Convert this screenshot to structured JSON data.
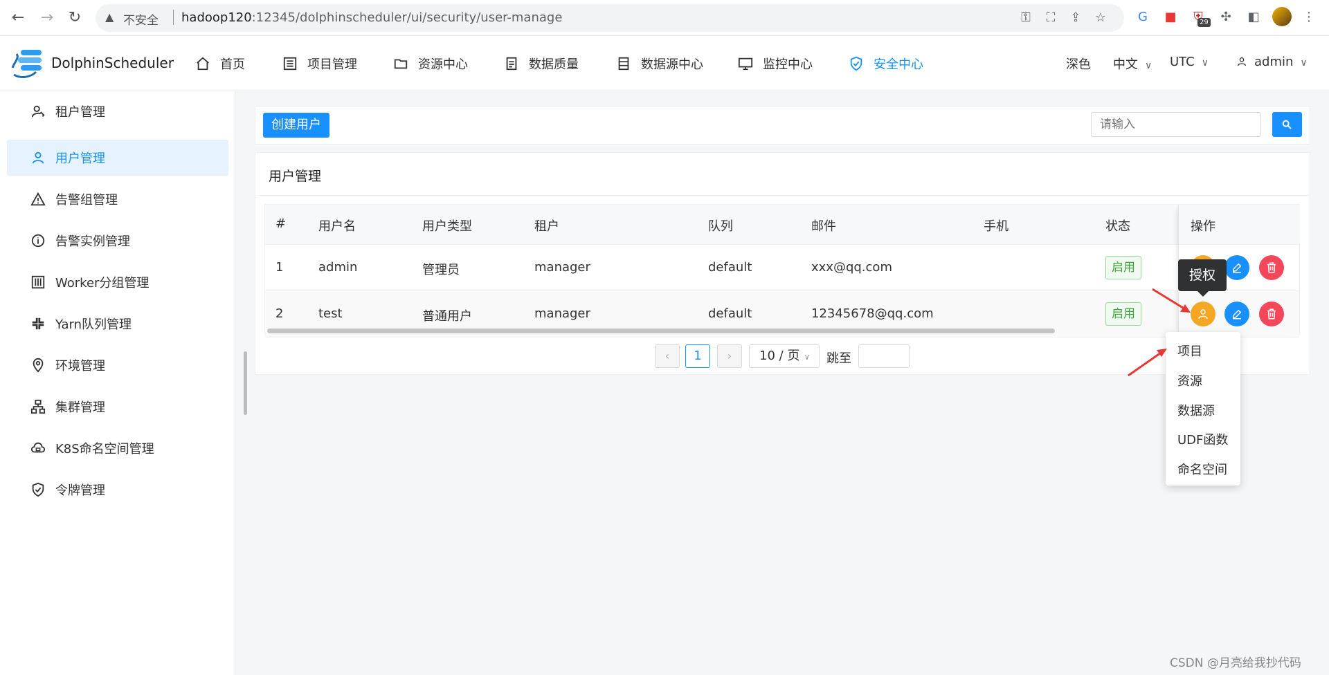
{
  "browser": {
    "insecure_label": "不安全",
    "url_host": "hadoop120",
    "url_path": ":12345/dolphinscheduler/ui/security/user-manage",
    "ext_badge": "29"
  },
  "header": {
    "brand": "DolphinScheduler",
    "nav": [
      {
        "label": "首页",
        "icon": "home-icon"
      },
      {
        "label": "项目管理",
        "icon": "project-list-icon"
      },
      {
        "label": "资源中心",
        "icon": "folder-icon"
      },
      {
        "label": "数据质量",
        "icon": "document-icon"
      },
      {
        "label": "数据源中心",
        "icon": "database-icon"
      },
      {
        "label": "监控中心",
        "icon": "monitor-icon"
      },
      {
        "label": "安全中心",
        "icon": "shield-check-icon",
        "active": true
      }
    ],
    "theme_label": "深色",
    "language": "中文",
    "timezone": "UTC",
    "user": "admin"
  },
  "sidebar": {
    "items": [
      {
        "label": "租户管理",
        "icon": "tenant-icon"
      },
      {
        "label": "用户管理",
        "icon": "user-icon",
        "active": true
      },
      {
        "label": "告警组管理",
        "icon": "warning-icon"
      },
      {
        "label": "告警实例管理",
        "icon": "info-icon"
      },
      {
        "label": "Worker分组管理",
        "icon": "worker-group-icon"
      },
      {
        "label": "Yarn队列管理",
        "icon": "yarn-queue-icon"
      },
      {
        "label": "环境管理",
        "icon": "location-icon"
      },
      {
        "label": "集群管理",
        "icon": "cluster-icon"
      },
      {
        "label": "K8S命名空间管理",
        "icon": "k8s-icon"
      },
      {
        "label": "令牌管理",
        "icon": "token-shield-icon"
      }
    ]
  },
  "toolbar": {
    "create_label": "创建用户",
    "search_placeholder": "请输入"
  },
  "card": {
    "title": "用户管理"
  },
  "table": {
    "columns": [
      "#",
      "用户名",
      "用户类型",
      "租户",
      "队列",
      "邮件",
      "手机",
      "状态",
      "操作"
    ],
    "rows": [
      {
        "index": "1",
        "username": "admin",
        "type": "管理员",
        "tenant": "manager",
        "queue": "default",
        "email": "xxx@qq.com",
        "phone": "",
        "status": "启用"
      },
      {
        "index": "2",
        "username": "test",
        "type": "普通用户",
        "tenant": "manager",
        "queue": "default",
        "email": "12345678@qq.com",
        "phone": "",
        "status": "启用"
      }
    ]
  },
  "pagination": {
    "current": "1",
    "page_size": "10 / 页",
    "jump_label": "跳至"
  },
  "tooltip": {
    "label": "授权"
  },
  "dropdown": {
    "items": [
      "项目",
      "资源",
      "数据源",
      "UDF函数",
      "命名空间"
    ]
  },
  "colors": {
    "primary": "#1890ff",
    "authorize": "#f5a623",
    "edit": "#1890ff",
    "delete": "#f5475a",
    "status_green": "#3ca43c"
  },
  "watermark": "CSDN @月亮给我抄代码"
}
